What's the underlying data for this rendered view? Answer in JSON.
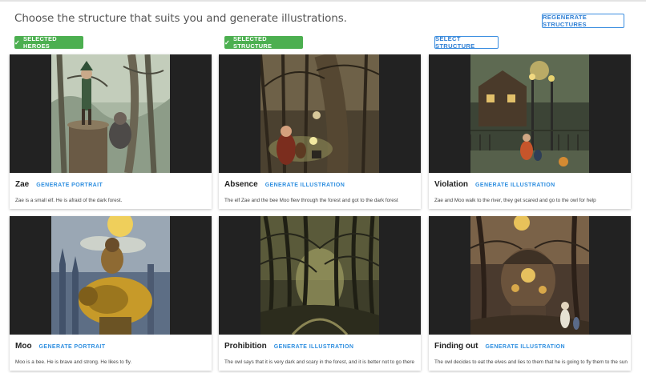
{
  "header": {
    "title": "Choose the structure that suits you and generate illustrations.",
    "regenerate_label": "REGENERATE STRUCTURES"
  },
  "columns": [
    {
      "label": "SELECTED HEROES",
      "selected": true
    },
    {
      "label": "SELECTED STRUCTURE",
      "selected": true
    },
    {
      "label": "SELECT STRUCTURE",
      "selected": false
    }
  ],
  "cards": [
    {
      "title": "Zae",
      "action": "GENERATE PORTRAIT",
      "description": "Zae is a small elf. He is afraid of the dark forest."
    },
    {
      "title": "Absence",
      "action": "GENERATE ILLUSTRATION",
      "description": "The elf Zae and the bee Moo flew through the forest and got to the dark forest"
    },
    {
      "title": "Violation",
      "action": "GENERATE ILLUSTRATION",
      "description": "Zae and Moo walk to the river, they get scared and go to the owl for help"
    },
    {
      "title": "Moo",
      "action": "GENERATE PORTRAIT",
      "description": "Moo is a bee. He is brave and strong. He likes to fly."
    },
    {
      "title": "Prohibition",
      "action": "GENERATE ILLUSTRATION",
      "description": "The owl says that it is very dark and scary in the forest, and it is better not to go there"
    },
    {
      "title": "Finding out",
      "action": "GENERATE ILLUSTRATION",
      "description": "The owl decides to eat the elves and lies to them that he is going to fly them to the sun"
    }
  ],
  "colors": {
    "accent": "#2f8fe0",
    "selected": "#4caf50",
    "letterbox": "#222222"
  }
}
